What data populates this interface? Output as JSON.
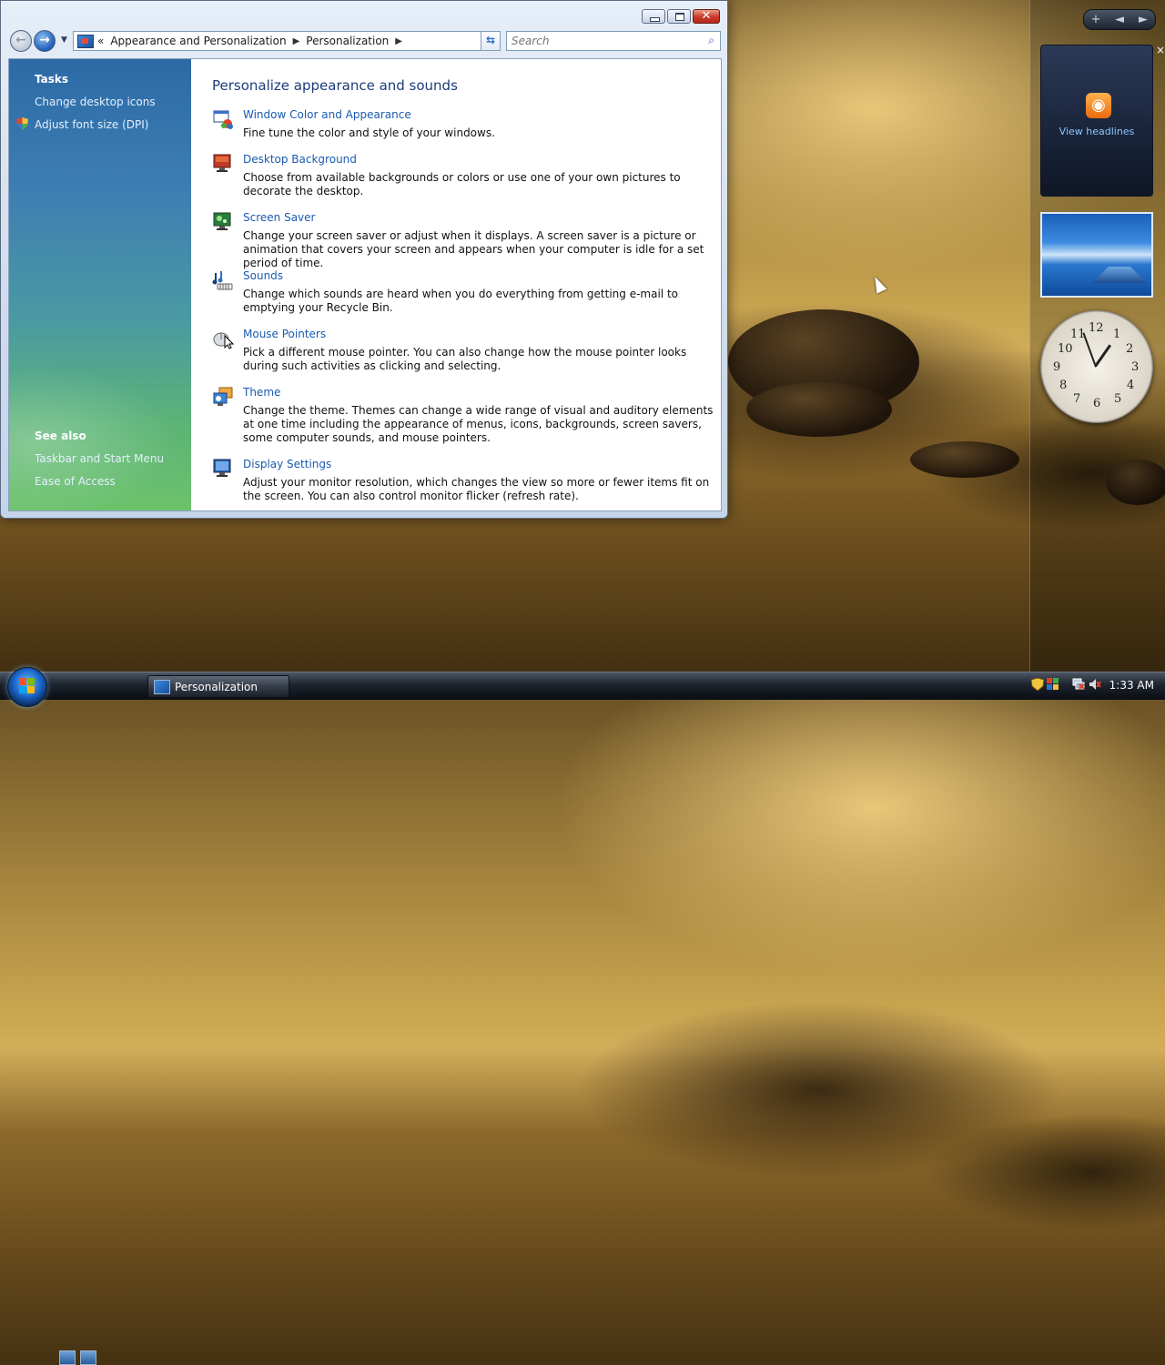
{
  "window": {
    "address": {
      "overflow": "«",
      "crumb1": "Appearance and Personalization",
      "crumb2": "Personalization"
    },
    "search_placeholder": "Search",
    "tasks": {
      "heading": "Tasks",
      "items": [
        "Change desktop icons",
        "Adjust font size (DPI)"
      ]
    },
    "see_also": {
      "heading": "See also",
      "items": [
        "Taskbar and Start Menu",
        "Ease of Access"
      ]
    },
    "page_title": "Personalize appearance and sounds",
    "items": [
      {
        "title": "Window Color and Appearance",
        "desc": "Fine tune the color and style of your windows."
      },
      {
        "title": "Desktop Background",
        "desc": "Choose from available backgrounds or colors or use one of your own pictures to decorate the desktop."
      },
      {
        "title": "Screen Saver",
        "desc": "Change your screen saver or adjust when it displays. A screen saver is a picture or animation that covers your screen and appears when your computer is idle for a set period of time."
      },
      {
        "title": "Sounds",
        "desc": "Change which sounds are heard when you do everything from getting e-mail to emptying your Recycle Bin."
      },
      {
        "title": "Mouse Pointers",
        "desc": "Pick a different mouse pointer. You can also change how the mouse pointer looks during such activities as clicking and selecting."
      },
      {
        "title": "Theme",
        "desc": "Change the theme. Themes can change a wide range of visual and auditory elements at one time including the appearance of menus, icons, backgrounds, screen savers, some computer sounds, and mouse pointers."
      },
      {
        "title": "Display Settings",
        "desc": "Adjust your monitor resolution, which changes the view so more or fewer items fit on the screen. You can also control monitor flicker (refresh rate)."
      }
    ]
  },
  "sidebar": {
    "add_label": "+",
    "prev_label": "◄",
    "next_label": "►",
    "close_label": "×",
    "feeds_label": "View headlines",
    "clock_numbers": [
      "12",
      "1",
      "2",
      "3",
      "4",
      "5",
      "6",
      "7",
      "8",
      "9",
      "10",
      "11"
    ]
  },
  "taskbar": {
    "task_label": "Personalization",
    "time": "1:33 AM"
  },
  "colors": {
    "link": "#1a5bb0",
    "title": "#1e3b7a",
    "pane_top": "#2c6aa6",
    "pane_bottom": "#6cc26b"
  }
}
